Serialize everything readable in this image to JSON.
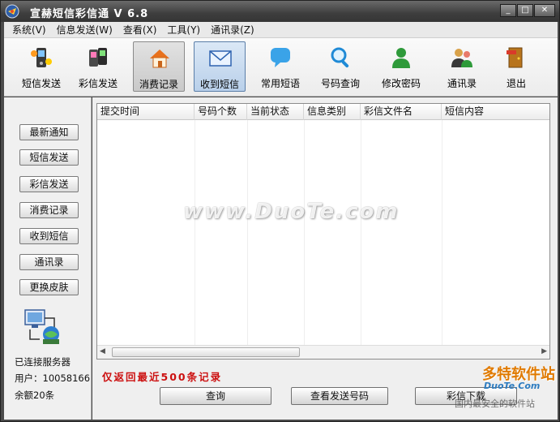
{
  "window": {
    "title": "宣赫短信彩信通 V 6.8",
    "controls": [
      "_",
      "□",
      "✕"
    ]
  },
  "menu": [
    "系统(V)",
    "信息发送(W)",
    "查看(X)",
    "工具(Y)",
    "通讯录(Z)"
  ],
  "toolbar": [
    {
      "label": "短信发送",
      "icon": "sms-phone-icon"
    },
    {
      "label": "彩信发送",
      "icon": "mms-phones-icon"
    },
    {
      "label": "消费记录",
      "icon": "home-icon",
      "state": "selected"
    },
    {
      "label": "收到短信",
      "icon": "envelope-icon",
      "state": "active"
    },
    {
      "label": "常用短语",
      "icon": "speech-bubble-icon"
    },
    {
      "label": "号码查询",
      "icon": "magnifier-icon"
    },
    {
      "label": "修改密码",
      "icon": "user-icon"
    },
    {
      "label": "通讯录",
      "icon": "contacts-icon"
    },
    {
      "label": "退出",
      "icon": "exit-door-icon"
    }
  ],
  "sidebar": {
    "buttons": [
      "最新通知",
      "短信发送",
      "彩信发送",
      "消费记录",
      "收到短信",
      "通讯录",
      "更换皮肤"
    ],
    "server_status": "已连接服务器",
    "user_label": "用户：",
    "user_id": "10058166",
    "balance": "余额20条"
  },
  "grid": {
    "columns": [
      "提交时间",
      "号码个数",
      "当前状态",
      "信息类别",
      "彩信文件名",
      "短信内容"
    ],
    "rows": []
  },
  "notice": "仅返回最近500条记录",
  "actions": {
    "query": "查询",
    "view_numbers": "查看发送号码",
    "mms_download": "彩信下载"
  },
  "watermark": {
    "main": "www.DuoTe.com",
    "corner_big": "多特软件站",
    "corner_mid": "DuoTe.Com",
    "corner_small": "国内最安全的软件站"
  },
  "colors": {
    "frame": "#4b4b4b",
    "notice_red": "#cc1010",
    "active_tool": "#b9d0ea"
  }
}
